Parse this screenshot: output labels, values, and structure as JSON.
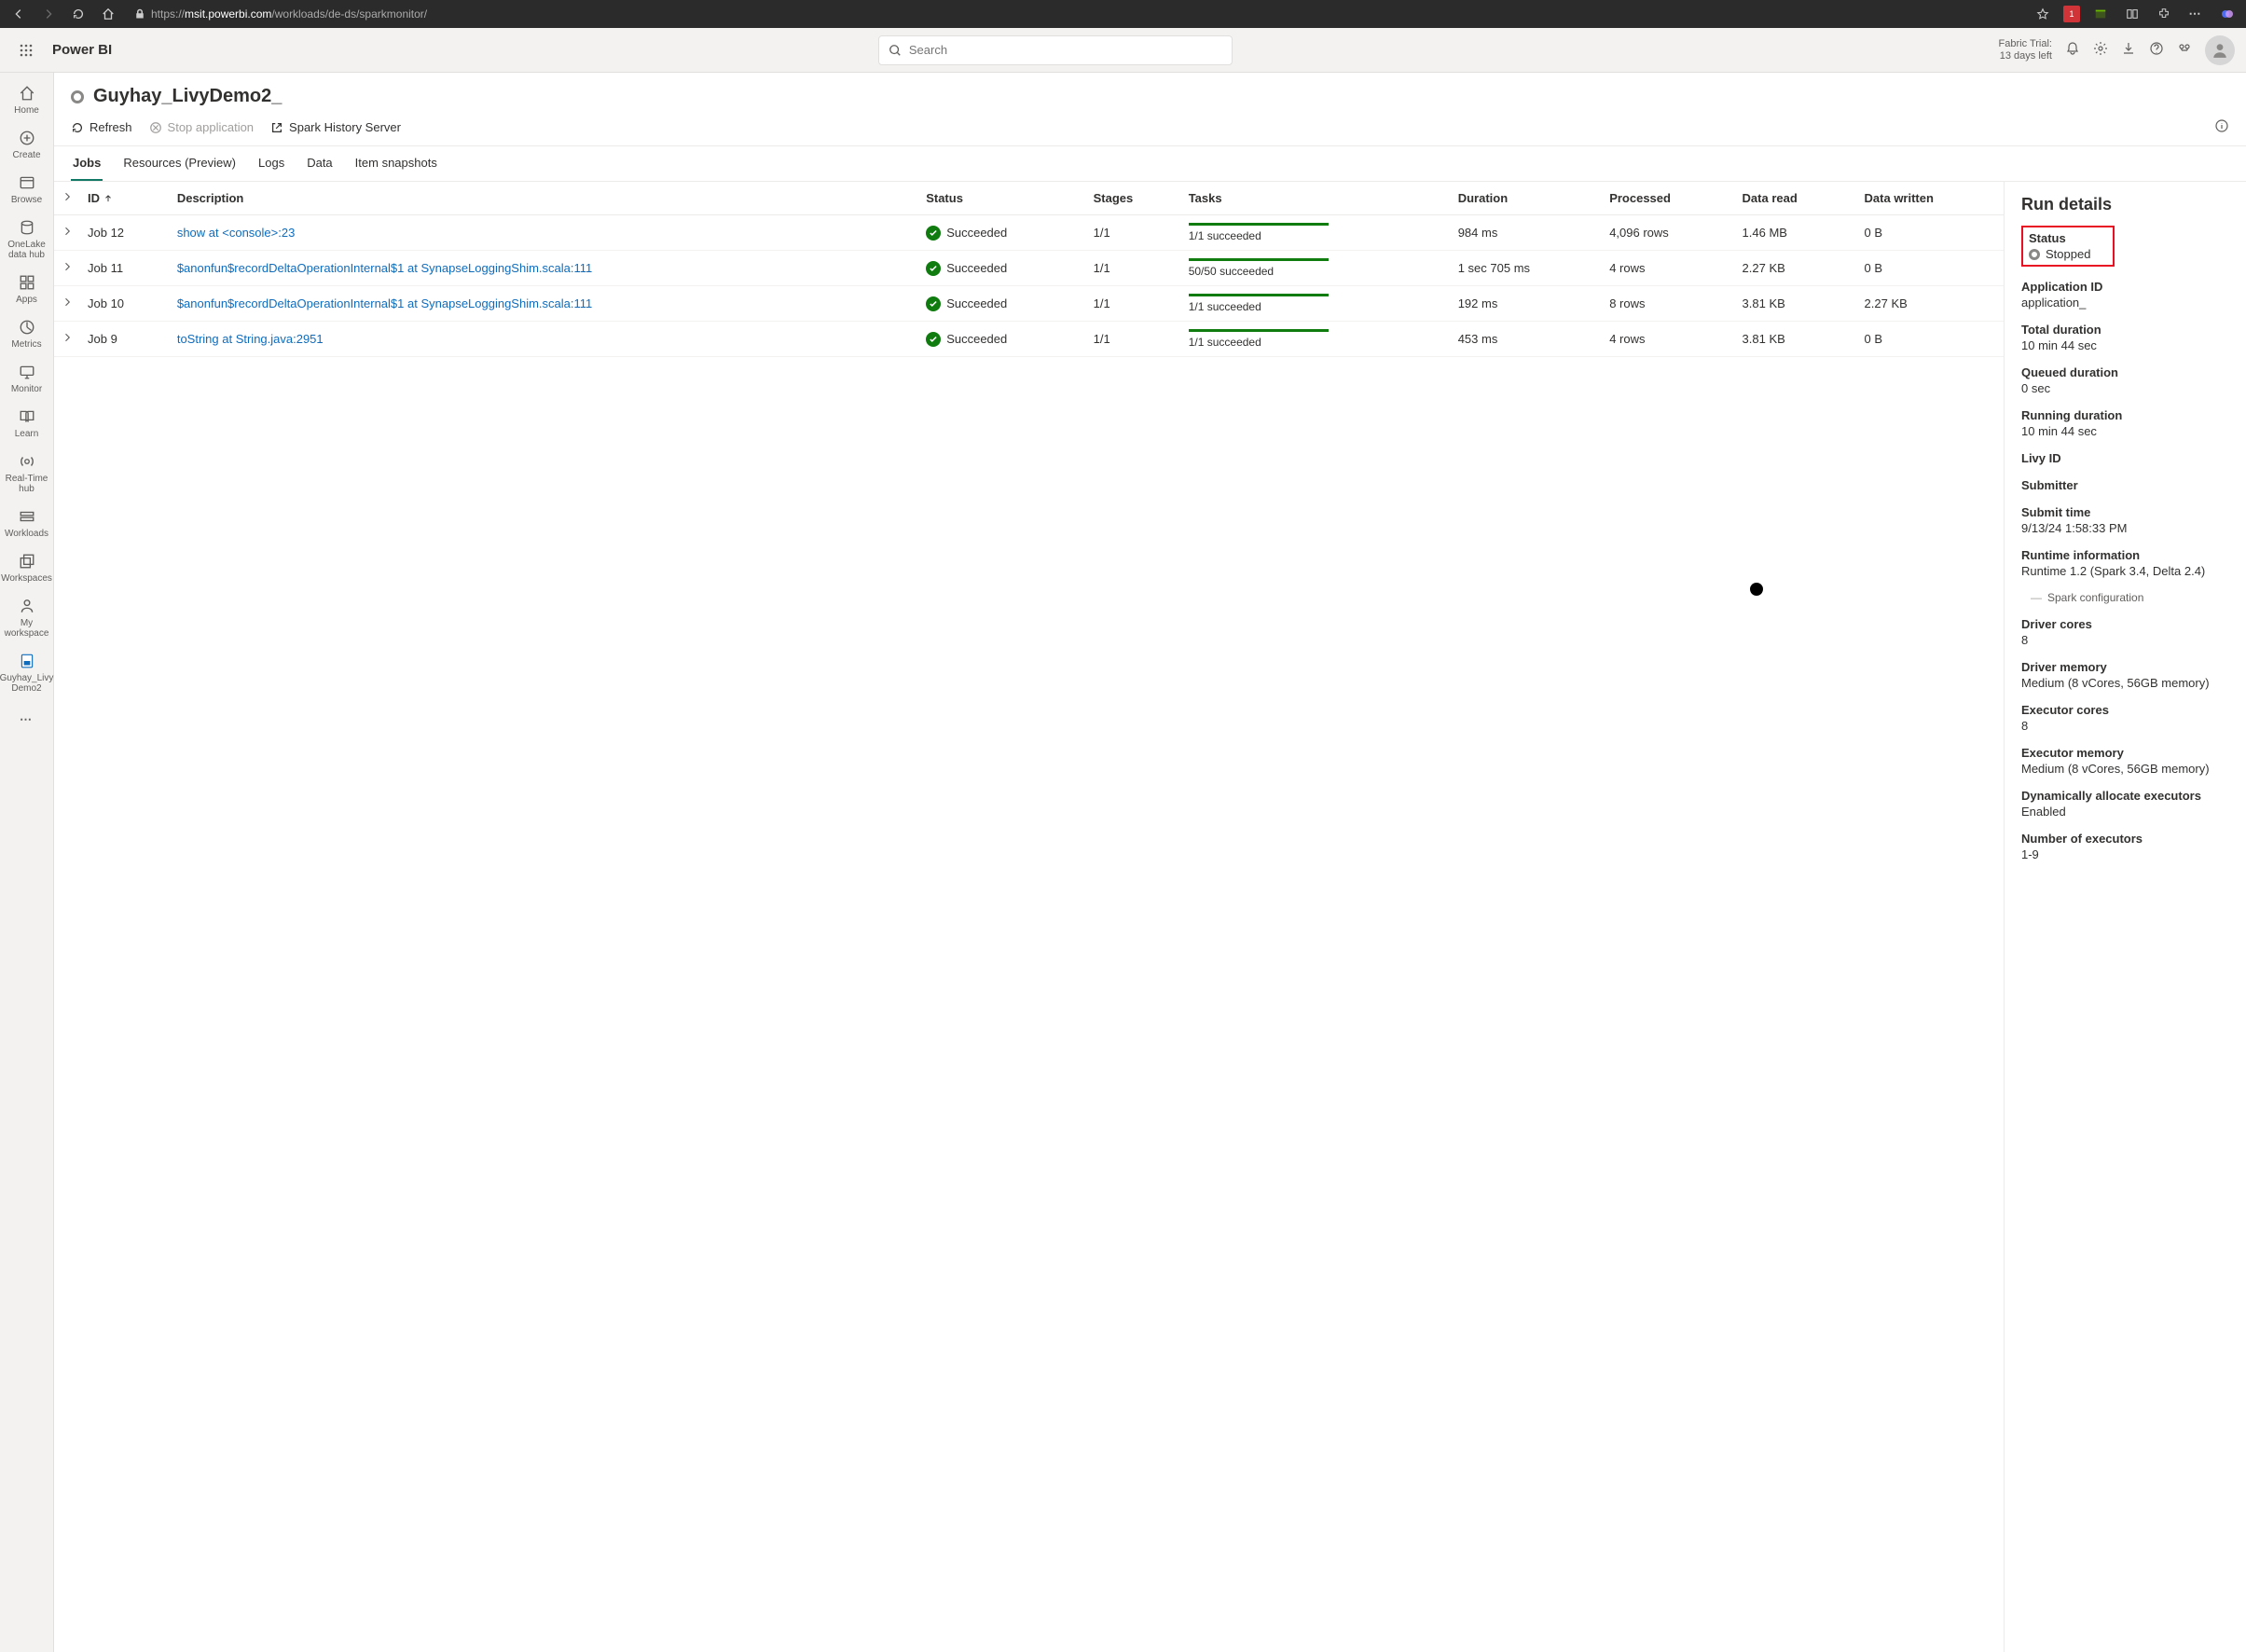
{
  "browser": {
    "url_host": "msit.powerbi.com",
    "url_path": "/workloads/de-ds/sparkmonitor/"
  },
  "app": {
    "title": "Power BI",
    "search_placeholder": "Search",
    "trial_line1": "Fabric Trial:",
    "trial_line2": "13 days left"
  },
  "rail": [
    {
      "label": "Home"
    },
    {
      "label": "Create"
    },
    {
      "label": "Browse"
    },
    {
      "label": "OneLake data hub"
    },
    {
      "label": "Apps"
    },
    {
      "label": "Metrics"
    },
    {
      "label": "Monitor"
    },
    {
      "label": "Learn"
    },
    {
      "label": "Real-Time hub"
    },
    {
      "label": "Workloads"
    },
    {
      "label": "Workspaces"
    },
    {
      "label": "My workspace"
    },
    {
      "label": "Guyhay_Livy Demo2"
    }
  ],
  "page": {
    "title": "Guyhay_LivyDemo2_"
  },
  "toolbar": {
    "refresh": "Refresh",
    "stop": "Stop application",
    "history": "Spark History Server"
  },
  "tabs": [
    "Jobs",
    "Resources (Preview)",
    "Logs",
    "Data",
    "Item snapshots"
  ],
  "columns": {
    "id": "ID",
    "description": "Description",
    "status": "Status",
    "stages": "Stages",
    "tasks": "Tasks",
    "duration": "Duration",
    "processed": "Processed",
    "data_read": "Data read",
    "data_written": "Data written"
  },
  "jobs": [
    {
      "id": "Job 12",
      "desc": "show at <console>:23",
      "status": "Succeeded",
      "stages": "1/1",
      "tasks": "1/1 succeeded",
      "duration": "984 ms",
      "processed": "4,096 rows",
      "read": "1.46 MB",
      "written": "0 B"
    },
    {
      "id": "Job 11",
      "desc": "$anonfun$recordDeltaOperationInternal$1 at SynapseLoggingShim.scala:111",
      "status": "Succeeded",
      "stages": "1/1",
      "tasks": "50/50 succeeded",
      "duration": "1 sec 705 ms",
      "processed": "4 rows",
      "read": "2.27 KB",
      "written": "0 B"
    },
    {
      "id": "Job 10",
      "desc": "$anonfun$recordDeltaOperationInternal$1 at SynapseLoggingShim.scala:111",
      "status": "Succeeded",
      "stages": "1/1",
      "tasks": "1/1 succeeded",
      "duration": "192 ms",
      "processed": "8 rows",
      "read": "3.81 KB",
      "written": "2.27 KB"
    },
    {
      "id": "Job 9",
      "desc": "toString at String.java:2951",
      "status": "Succeeded",
      "stages": "1/1",
      "tasks": "1/1 succeeded",
      "duration": "453 ms",
      "processed": "4 rows",
      "read": "3.81 KB",
      "written": "0 B"
    }
  ],
  "details": {
    "heading": "Run details",
    "status_label": "Status",
    "status_value": "Stopped",
    "app_id_label": "Application ID",
    "app_id_value": "application_",
    "total_dur_label": "Total duration",
    "total_dur_value": "10 min 44 sec",
    "queued_label": "Queued duration",
    "queued_value": "0 sec",
    "running_label": "Running duration",
    "running_value": "10 min 44 sec",
    "livy_label": "Livy ID",
    "livy_value": "",
    "submitter_label": "Submitter",
    "submitter_value": "",
    "submit_time_label": "Submit time",
    "submit_time_value": "9/13/24 1:58:33 PM",
    "runtime_label": "Runtime information",
    "runtime_value": "Runtime 1.2 (Spark 3.4, Delta 2.4)",
    "spark_config": "Spark configuration",
    "driver_cores_label": "Driver cores",
    "driver_cores_value": "8",
    "driver_mem_label": "Driver memory",
    "driver_mem_value": "Medium (8 vCores, 56GB memory)",
    "exec_cores_label": "Executor cores",
    "exec_cores_value": "8",
    "exec_mem_label": "Executor memory",
    "exec_mem_value": "Medium (8 vCores, 56GB memory)",
    "dyn_label": "Dynamically allocate executors",
    "dyn_value": "Enabled",
    "num_exec_label": "Number of executors",
    "num_exec_value": "1-9"
  }
}
